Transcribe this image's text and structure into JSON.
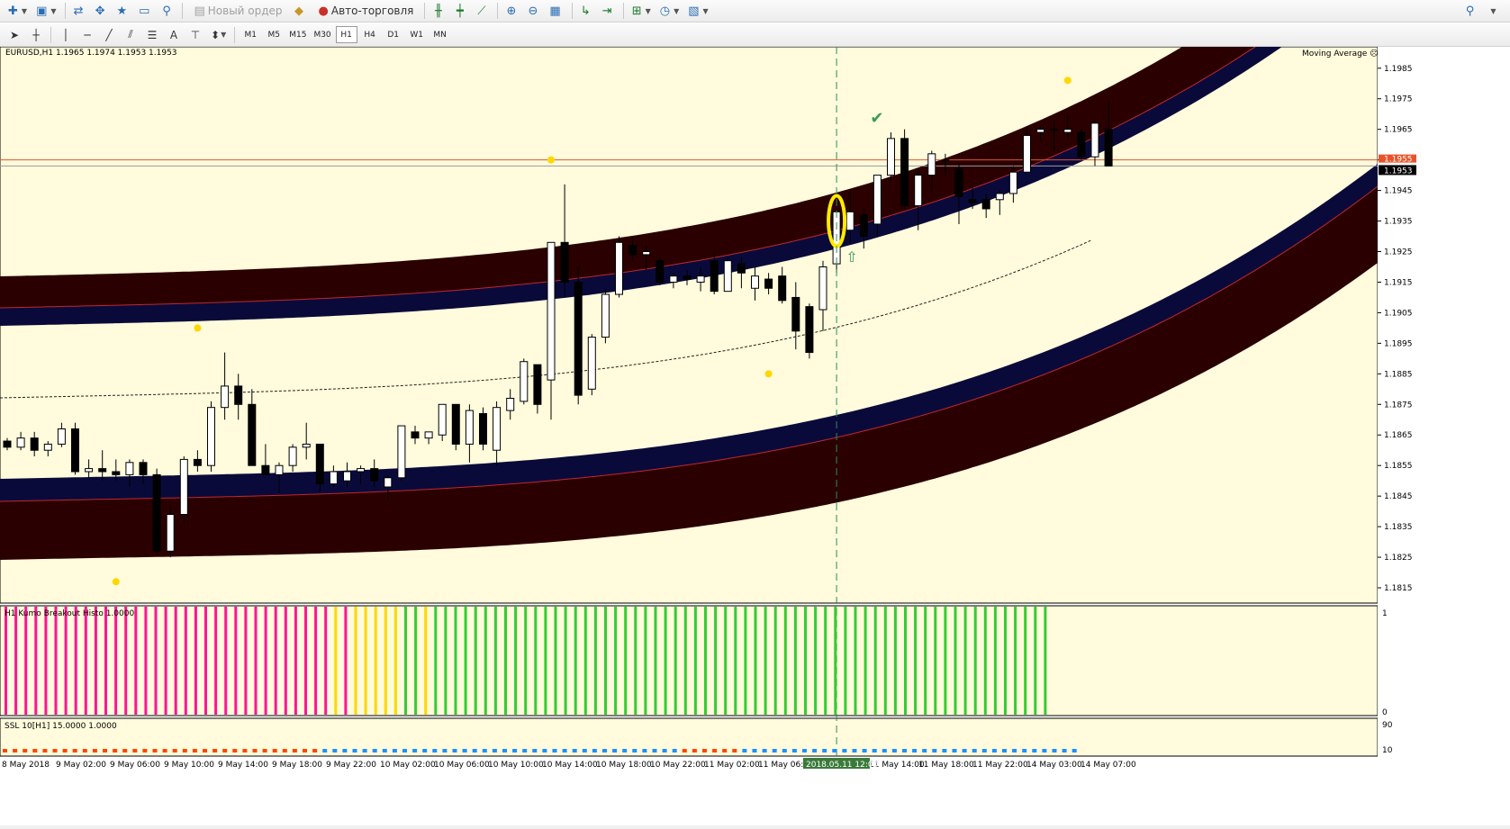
{
  "toolbar": {
    "new_order_label": "Новый ордер",
    "autotrading_label": "Авто-торговля",
    "timeframes": [
      "M1",
      "M5",
      "M15",
      "M30",
      "H1",
      "H4",
      "D1",
      "W1",
      "MN"
    ],
    "active_timeframe": "H1"
  },
  "chart": {
    "symbol_info": "EURUSD,H1  1.1965 1.1974 1.1953 1.1953",
    "indicator_name": "Moving Average",
    "price_ticks": [
      "1.1985",
      "1.1975",
      "1.1965",
      "1.1955",
      "1.1945",
      "1.1935",
      "1.1925",
      "1.1915",
      "1.1905",
      "1.1895",
      "1.1885",
      "1.1875",
      "1.1865",
      "1.1855",
      "1.1845",
      "1.1835",
      "1.1825",
      "1.1815"
    ],
    "price_min": 1.181,
    "price_max": 1.1992,
    "bid_label": "1.1953",
    "ask_label": "1.1955",
    "candles_ohlc": [
      [
        1.1863,
        1.1864,
        1.186,
        1.1861
      ],
      [
        1.1861,
        1.1866,
        1.186,
        1.1864
      ],
      [
        1.1864,
        1.1866,
        1.1858,
        1.186
      ],
      [
        1.186,
        1.1863,
        1.1858,
        1.1862
      ],
      [
        1.1862,
        1.1869,
        1.1861,
        1.1867
      ],
      [
        1.1867,
        1.1869,
        1.1852,
        1.1853
      ],
      [
        1.1853,
        1.1857,
        1.1851,
        1.1854
      ],
      [
        1.1854,
        1.186,
        1.185,
        1.1853
      ],
      [
        1.1853,
        1.1857,
        1.185,
        1.1852
      ],
      [
        1.1852,
        1.1857,
        1.1848,
        1.1856
      ],
      [
        1.1856,
        1.1857,
        1.1849,
        1.1852
      ],
      [
        1.1852,
        1.1854,
        1.1826,
        1.1827
      ],
      [
        1.1827,
        1.1842,
        1.1825,
        1.1839
      ],
      [
        1.1839,
        1.1858,
        1.1836,
        1.1857
      ],
      [
        1.1857,
        1.186,
        1.1853,
        1.1855
      ],
      [
        1.1855,
        1.1876,
        1.1853,
        1.1874
      ],
      [
        1.1874,
        1.1892,
        1.187,
        1.1881
      ],
      [
        1.1881,
        1.1885,
        1.187,
        1.1875
      ],
      [
        1.1875,
        1.188,
        1.1855,
        1.1855
      ],
      [
        1.1855,
        1.1862,
        1.1852,
        1.1852
      ],
      [
        1.1852,
        1.1856,
        1.1846,
        1.1855
      ],
      [
        1.1855,
        1.1862,
        1.1853,
        1.1861
      ],
      [
        1.1861,
        1.1869,
        1.1857,
        1.1862
      ],
      [
        1.1862,
        1.1862,
        1.1846,
        1.1849
      ],
      [
        1.1849,
        1.1855,
        1.1848,
        1.1853
      ],
      [
        1.185,
        1.1856,
        1.1848,
        1.1853
      ],
      [
        1.1853,
        1.1855,
        1.1849,
        1.1854
      ],
      [
        1.1854,
        1.1857,
        1.1848,
        1.185
      ],
      [
        1.1848,
        1.1852,
        1.1844,
        1.1851
      ],
      [
        1.1851,
        1.1868,
        1.185,
        1.1868
      ],
      [
        1.1866,
        1.1868,
        1.1862,
        1.1864
      ],
      [
        1.1864,
        1.1866,
        1.1862,
        1.1866
      ],
      [
        1.1865,
        1.1875,
        1.1863,
        1.1875
      ],
      [
        1.1875,
        1.1875,
        1.186,
        1.1862
      ],
      [
        1.1862,
        1.1875,
        1.1856,
        1.1873
      ],
      [
        1.1872,
        1.1874,
        1.186,
        1.1862
      ],
      [
        1.186,
        1.1876,
        1.1855,
        1.1874
      ],
      [
        1.1873,
        1.188,
        1.187,
        1.1877
      ],
      [
        1.1876,
        1.189,
        1.1875,
        1.1889
      ],
      [
        1.1888,
        1.1888,
        1.1872,
        1.1875
      ],
      [
        1.1883,
        1.1928,
        1.187,
        1.1928
      ],
      [
        1.1928,
        1.1947,
        1.191,
        1.1915
      ],
      [
        1.1915,
        1.192,
        1.1875,
        1.1878
      ],
      [
        1.188,
        1.1898,
        1.1878,
        1.1897
      ],
      [
        1.1897,
        1.1913,
        1.1895,
        1.1911
      ],
      [
        1.1911,
        1.193,
        1.191,
        1.1928
      ],
      [
        1.1927,
        1.193,
        1.1922,
        1.1924
      ],
      [
        1.1924,
        1.1927,
        1.1919,
        1.1925
      ],
      [
        1.1922,
        1.1923,
        1.1914,
        1.1915
      ],
      [
        1.1915,
        1.1918,
        1.1913,
        1.1917
      ],
      [
        1.1917,
        1.1919,
        1.1914,
        1.1916
      ],
      [
        1.1915,
        1.192,
        1.1912,
        1.1917
      ],
      [
        1.1922,
        1.1925,
        1.1911,
        1.1912
      ],
      [
        1.1912,
        1.1923,
        1.1912,
        1.1922
      ],
      [
        1.1921,
        1.1923,
        1.1913,
        1.1918
      ],
      [
        1.1913,
        1.192,
        1.1909,
        1.1917
      ],
      [
        1.1916,
        1.1918,
        1.1911,
        1.1913
      ],
      [
        1.1917,
        1.192,
        1.1908,
        1.1909
      ],
      [
        1.191,
        1.1915,
        1.1893,
        1.1899
      ],
      [
        1.1907,
        1.1908,
        1.189,
        1.1892
      ],
      [
        1.1906,
        1.1922,
        1.1899,
        1.192
      ],
      [
        1.1921,
        1.1936,
        1.1918,
        1.1938
      ],
      [
        1.1932,
        1.1945,
        1.1928,
        1.1938
      ],
      [
        1.1937,
        1.1939,
        1.1926,
        1.193
      ],
      [
        1.1934,
        1.195,
        1.193,
        1.195
      ],
      [
        1.195,
        1.1964,
        1.1948,
        1.1962
      ],
      [
        1.1962,
        1.1965,
        1.1939,
        1.194
      ],
      [
        1.194,
        1.1952,
        1.1932,
        1.195
      ],
      [
        1.195,
        1.1958,
        1.1945,
        1.1957
      ],
      [
        1.1955,
        1.1957,
        1.195,
        1.1955
      ],
      [
        1.1952,
        1.1954,
        1.1934,
        1.1943
      ],
      [
        1.1942,
        1.1946,
        1.1939,
        1.1941
      ],
      [
        1.1942,
        1.1944,
        1.1936,
        1.1939
      ],
      [
        1.1942,
        1.1945,
        1.1937,
        1.1944
      ],
      [
        1.1944,
        1.1953,
        1.1941,
        1.1951
      ],
      [
        1.1951,
        1.1966,
        1.1951,
        1.1963
      ],
      [
        1.1964,
        1.1966,
        1.1961,
        1.1965
      ],
      [
        1.1965,
        1.1968,
        1.1958,
        1.1965
      ],
      [
        1.1964,
        1.197,
        1.1962,
        1.1965
      ],
      [
        1.1964,
        1.1965,
        1.1955,
        1.1956
      ],
      [
        1.1956,
        1.1968,
        1.1953,
        1.1967
      ],
      [
        1.1965,
        1.1974,
        1.1953,
        1.1953
      ]
    ],
    "signal_dots": [
      [
        7,
        1.19
      ],
      [
        20,
        1.1955
      ],
      [
        28,
        1.1885
      ],
      [
        4,
        1.1817
      ],
      [
        39,
        1.1981
      ]
    ],
    "time_labels": [
      "8 May 2018",
      "9 May 02:00",
      "9 May 06:00",
      "9 May 10:00",
      "9 May 14:00",
      "9 May 18:00",
      "9 May 22:00",
      "10 May 02:00",
      "10 May 06:00",
      "10 May 10:00",
      "10 May 14:00",
      "10 May 18:00",
      "10 May 22:00",
      "11 May 02:00",
      "11 May 06:00",
      "11 May 14:00",
      "11 May 18:00",
      "11 May 22:00",
      "14 May 03:00",
      "14 May 07:00"
    ],
    "cursor_time_label": "2018.05.11 12:00"
  },
  "kumo": {
    "label": "H1  Kumo Breakout Histo 1.0000",
    "scale_top": "1",
    "scale_bottom": "0",
    "bar_colors": "PPPPPPPPPPPPPPPPPPPPPPPPPPPPPPPPPYPYYYYYGGYGGGGGGGGGGGGGGGGGGGGGGGGGGGGGGGGGGGGGGGGGGGGGGGGGGGGGGGGGGGGGG",
    "colors": {
      "P": "#ff1493",
      "Y": "#ffd700",
      "G": "#32cd32"
    }
  },
  "ssl": {
    "label": "SSL 10[H1] 15.0000 1.0000",
    "scale_top": "90",
    "scale_bottom": "10",
    "dot_colors": "RRRRRRRRRRRRRRRRRRRRRRRRRRRRRRRRBBBBBBBBBBBBBBBBBBBBBBBBBBBBBBBBBBBBRRRRRRBBBBBBBBBBBBBBBBBBBBBBBBBBBBBBBBBB",
    "colors": {
      "R": "#ff4500",
      "B": "#1e90ff"
    }
  },
  "theme": {
    "chart_bg": "#fffbdc",
    "band_red": "#2a0000",
    "band_navy": "#0a0a3a",
    "band_edge": "#c0282d",
    "bid_line": "#e8542a",
    "cursor_line": "#2e8b57"
  }
}
